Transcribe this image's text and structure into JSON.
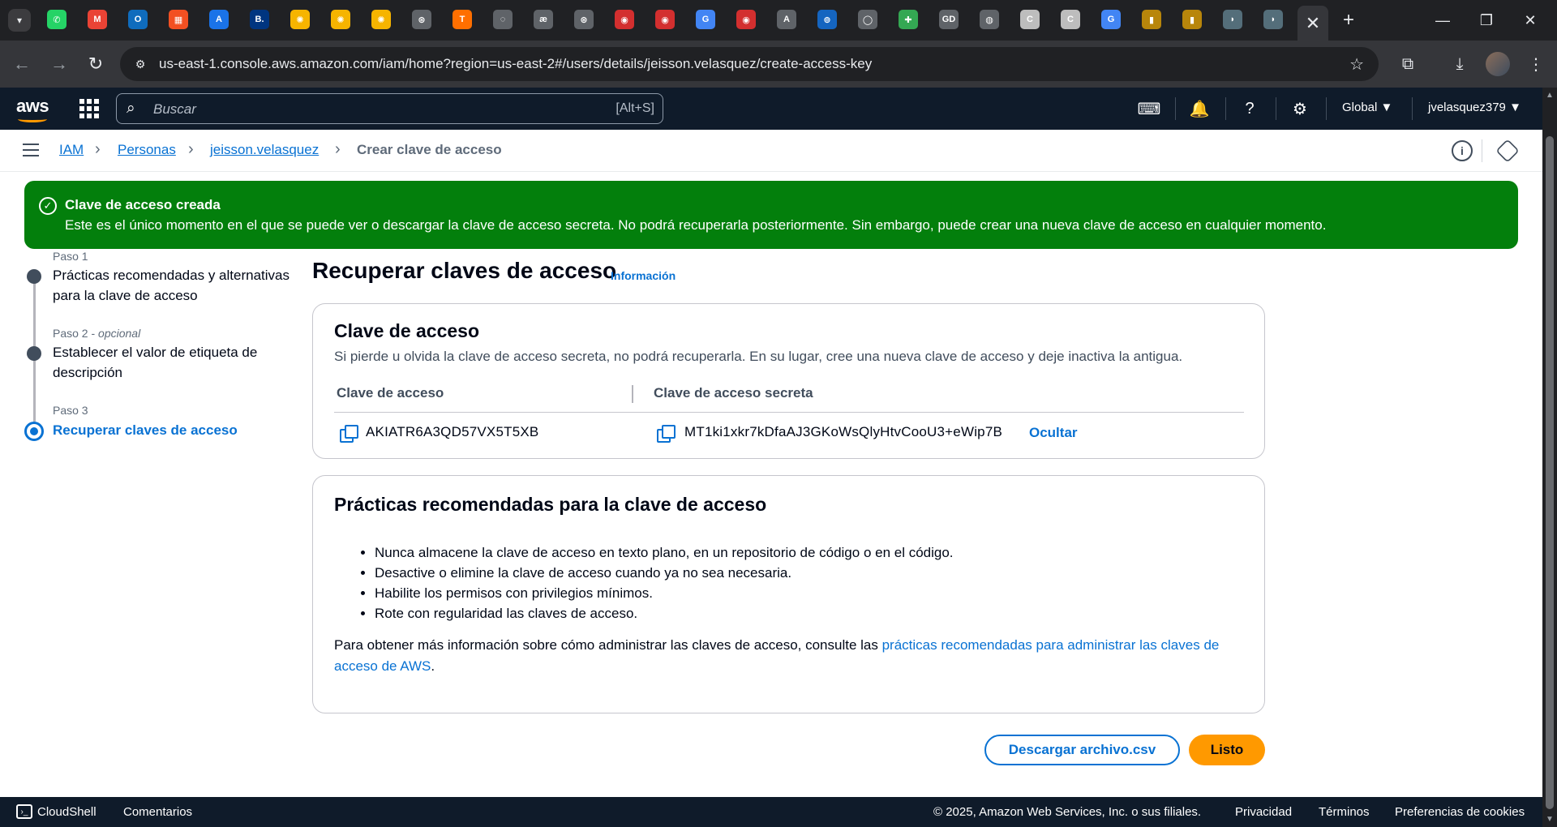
{
  "browser": {
    "url": "us-east-1.console.aws.amazon.com/iam/home?region=us-east-2#/users/details/jeisson.velasquez/create-access-key",
    "tab_icons": [
      {
        "name": "whatsapp-tab-icon",
        "glyph": "✆",
        "color": "#25d366"
      },
      {
        "name": "gmail-tab-icon",
        "glyph": "M",
        "color": "#ea4335"
      },
      {
        "name": "outlook-tab-icon",
        "glyph": "O",
        "color": "#0f6cbd"
      },
      {
        "name": "microsoft-tab-icon",
        "glyph": "▦",
        "color": "#f25022"
      },
      {
        "name": "translator-tab-icon",
        "glyph": "A",
        "color": "#1a73e8"
      },
      {
        "name": "booking-tab-icon",
        "glyph": "B.",
        "color": "#003580"
      },
      {
        "name": "sun-tab-icon-1",
        "glyph": "✺",
        "color": "#f6b400"
      },
      {
        "name": "sun-tab-icon-2",
        "glyph": "✺",
        "color": "#f6b400"
      },
      {
        "name": "sun-tab-icon-3",
        "glyph": "✺",
        "color": "#f6b400"
      },
      {
        "name": "openai-tab-icon-1",
        "glyph": "⊛",
        "color": "#5f6368"
      },
      {
        "name": "tensorflow-tab-icon",
        "glyph": "T",
        "color": "#ff6f00"
      },
      {
        "name": "loading-tab-icon",
        "glyph": "◌",
        "color": "#5f6368"
      },
      {
        "name": "ae-tab-icon",
        "glyph": "æ",
        "color": "#5f6368"
      },
      {
        "name": "openai-tab-icon-2",
        "glyph": "⊛",
        "color": "#5f6368"
      },
      {
        "name": "red-app-tab-icon-1",
        "glyph": "◉",
        "color": "#d32f2f"
      },
      {
        "name": "red-app-tab-icon-2",
        "glyph": "◉",
        "color": "#d32f2f"
      },
      {
        "name": "google-tab-icon-1",
        "glyph": "G",
        "color": "#4285f4"
      },
      {
        "name": "red-app-tab-icon-3",
        "glyph": "◉",
        "color": "#d32f2f"
      },
      {
        "name": "anthropic-tab-icon",
        "glyph": "A",
        "color": "#5f6368"
      },
      {
        "name": "vs-tab-icon",
        "glyph": "⊚",
        "color": "#1565c0"
      },
      {
        "name": "circle-tab-icon",
        "glyph": "◯",
        "color": "#5f6368"
      },
      {
        "name": "windows-tab-icon",
        "glyph": "✚",
        "color": "#34a853"
      },
      {
        "name": "gd-tab-icon",
        "glyph": "GD",
        "color": "#5f6368"
      },
      {
        "name": "globe-tab-icon",
        "glyph": "◍",
        "color": "#5f6368"
      },
      {
        "name": "c-doc-tab-icon-1",
        "glyph": "C",
        "color": "#bdbdbd"
      },
      {
        "name": "c-doc-tab-icon-2",
        "glyph": "C",
        "color": "#bdbdbd"
      },
      {
        "name": "google-tab-icon-2",
        "glyph": "G",
        "color": "#4285f4"
      },
      {
        "name": "book-tab-icon-1",
        "glyph": "▮",
        "color": "#b8860b"
      },
      {
        "name": "book-tab-icon-2",
        "glyph": "▮",
        "color": "#b8860b"
      },
      {
        "name": "app-tab-icon-1",
        "glyph": "◗",
        "color": "#546e7a"
      },
      {
        "name": "app-tab-icon-2",
        "glyph": "◗",
        "color": "#546e7a"
      }
    ]
  },
  "aws_nav": {
    "search_placeholder": "Buscar",
    "search_shortcut": "[Alt+S]",
    "region": "Global ▼",
    "account": "jvelasquez379 ▼"
  },
  "breadcrumb": {
    "items": [
      "IAM",
      "Personas",
      "jeisson.velasquez"
    ],
    "current": "Crear clave de acceso"
  },
  "flash": {
    "title": "Clave de acceso creada",
    "message": "Este es el único momento en el que se puede ver o descargar la clave de acceso secreta. No podrá recuperarla posteriormente. Sin embargo, puede crear una nueva clave de acceso en cualquier momento."
  },
  "steps": [
    {
      "label": "Paso 1",
      "optional": "",
      "name": "Prácticas recomendadas y alternativas para la clave de acceso"
    },
    {
      "label": "Paso 2 - ",
      "optional": "opcional",
      "name": "Establecer el valor de etiqueta de descripción"
    },
    {
      "label": "Paso 3",
      "optional": "",
      "name": "Recuperar claves de acceso"
    }
  ],
  "main": {
    "title": "Recuperar claves de acceso",
    "info_link": "Información",
    "keys_card": {
      "title": "Clave de acceso",
      "description": "Si pierde u olvida la clave de acceso secreta, no podrá recuperarla. En su lugar, cree una nueva clave de acceso y deje inactiva la antigua.",
      "col_access_key": "Clave de acceso",
      "col_secret_key": "Clave de acceso secreta",
      "access_key": "AKIATR6A3QD57VX5T5XB",
      "secret_key": "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",
      "hide_label": "Ocultar"
    },
    "practices_card": {
      "title": "Prácticas recomendadas para la clave de acceso",
      "bullets": [
        "Nunca almacene la clave de acceso en texto plano, en un repositorio de código o en el código.",
        "Desactive o elimine la clave de acceso cuando ya no sea necesaria.",
        "Habilite los permisos con privilegios mínimos.",
        "Rote con regularidad las claves de acceso."
      ],
      "more_prefix": "Para obtener más información sobre cómo administrar las claves de acceso, consulte las ",
      "more_link": "prácticas recomendadas para administrar las claves de acceso de AWS",
      "more_suffix": "."
    },
    "download_button": "Descargar archivo.csv",
    "done_button": "Listo"
  },
  "footer": {
    "cloudshell": "CloudShell",
    "feedback": "Comentarios",
    "copyright": "© 2025, Amazon Web Services, Inc. o sus filiales.",
    "privacy": "Privacidad",
    "terms": "Términos",
    "cookies": "Preferencias de cookies"
  },
  "colors": {
    "aws_nav_bg": "#0f1b2a",
    "link": "#0972d3",
    "success": "#037f0c",
    "primary_button": "#ff9900"
  }
}
